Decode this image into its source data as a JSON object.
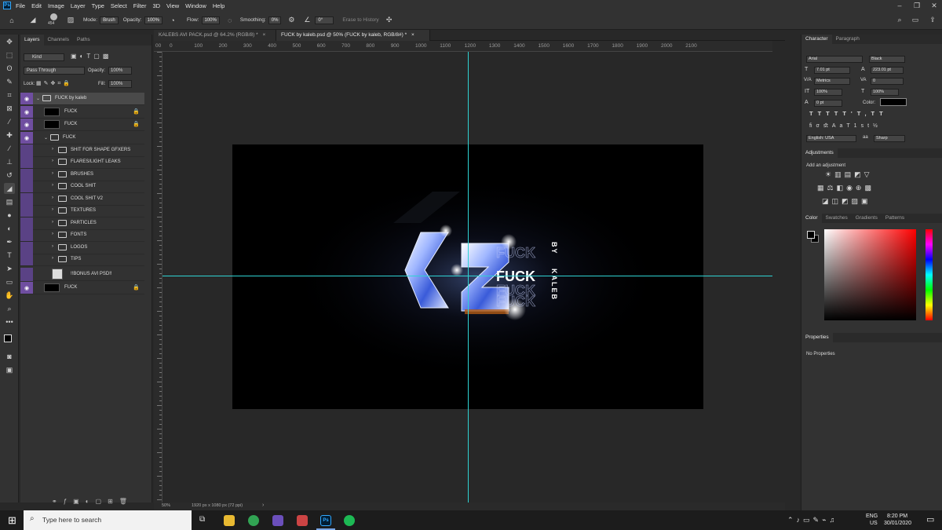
{
  "menubar": {
    "app_icon": "Ps",
    "items": [
      "File",
      "Edit",
      "Image",
      "Layer",
      "Type",
      "Select",
      "Filter",
      "3D",
      "View",
      "Window",
      "Help"
    ]
  },
  "options": {
    "brush_size": "454",
    "mode_label": "Mode:",
    "mode_value": "Brush",
    "opacity_label": "Opacity:",
    "opacity_value": "100%",
    "flow_label": "Flow:",
    "flow_value": "100%",
    "smoothing_label": "Smoothing:",
    "smoothing_value": "0%",
    "angle_value": "0°",
    "erase_history_label": "Erase to History"
  },
  "tabs": [
    {
      "label": "KALEBS AVI PACK.psd @ 64.2% (RGB/8) *"
    },
    {
      "label": "FUCK by kaleb.psd @ 50% (FUCK by kaleb, RGB/8#) *"
    }
  ],
  "ruler_top": [
    "0",
    "100",
    "200",
    "300",
    "400",
    "500",
    "600",
    "700",
    "800",
    "900",
    "1000",
    "1100",
    "1200",
    "1300",
    "1400",
    "1500",
    "1600",
    "1700",
    "1800",
    "1900",
    "2000",
    "2100"
  ],
  "ruler_top_left": "00",
  "layers_panel": {
    "tabs": [
      "Layers",
      "Channels",
      "Paths"
    ],
    "kind_label": "Kind",
    "blend_mode": "Pass Through",
    "opacity_label": "Opacity:",
    "opacity_value": "100%",
    "lock_label": "Lock:",
    "fill_label": "Fill:",
    "fill_value": "100%",
    "layers": [
      {
        "name": "FUCK by kaleb",
        "type": "group"
      },
      {
        "name": "FUCK",
        "type": "layer"
      },
      {
        "name": "FUCK",
        "type": "layer"
      },
      {
        "name": "FUCK",
        "type": "group"
      },
      {
        "name": "SHIT FOR SHAPE GFXERS",
        "type": "group"
      },
      {
        "name": "FLARES/LIGHT LEAKS",
        "type": "group"
      },
      {
        "name": "BRUSHES",
        "type": "group"
      },
      {
        "name": "COOL SHIT",
        "type": "group"
      },
      {
        "name": "COOL SHIT V2",
        "type": "group"
      },
      {
        "name": "TEXTURES",
        "type": "group"
      },
      {
        "name": "PARTICLES",
        "type": "group"
      },
      {
        "name": "FONTS",
        "type": "group"
      },
      {
        "name": "LOGOS",
        "type": "group"
      },
      {
        "name": "TIPS",
        "type": "group"
      },
      {
        "name": "!!BONUS AVI PSD!!",
        "type": "layer"
      },
      {
        "name": "FUCK",
        "type": "layer"
      }
    ]
  },
  "artwork": {
    "main_text": "FUCK",
    "vertical_by": "BY",
    "vertical_name": "KALEB"
  },
  "status": {
    "zoom": "50%",
    "doc_size": "1920 px x 1080 px (72 ppi)"
  },
  "character_panel": {
    "tabs": [
      "Character",
      "Paragraph"
    ],
    "font_family": "Arial",
    "font_style": "Black",
    "font_size": "7.01 pt",
    "leading": "223.01 pt",
    "kerning": "Metrics",
    "tracking": "0",
    "vscale": "100%",
    "hscale": "100%",
    "baseline": "0 pt",
    "color_label": "Color:",
    "language": "English: USA",
    "antialias_label": "aa",
    "antialias": "Sharp"
  },
  "adjustments_panel": {
    "title": "Adjustments",
    "hint": "Add an adjustment"
  },
  "color_panel": {
    "tabs": [
      "Color",
      "Swatches",
      "Gradients",
      "Patterns"
    ]
  },
  "properties_panel": {
    "title": "Properties",
    "text": "No Properties"
  },
  "taskbar": {
    "search_placeholder": "Type here to search",
    "lang": "ENG",
    "region": "US",
    "time": "8:20 PM",
    "date": "30/01/2020"
  },
  "colors": {
    "guide": "#2fd3d3",
    "layer_eye": "#6f4ea0",
    "accent": "#31a8ff"
  }
}
